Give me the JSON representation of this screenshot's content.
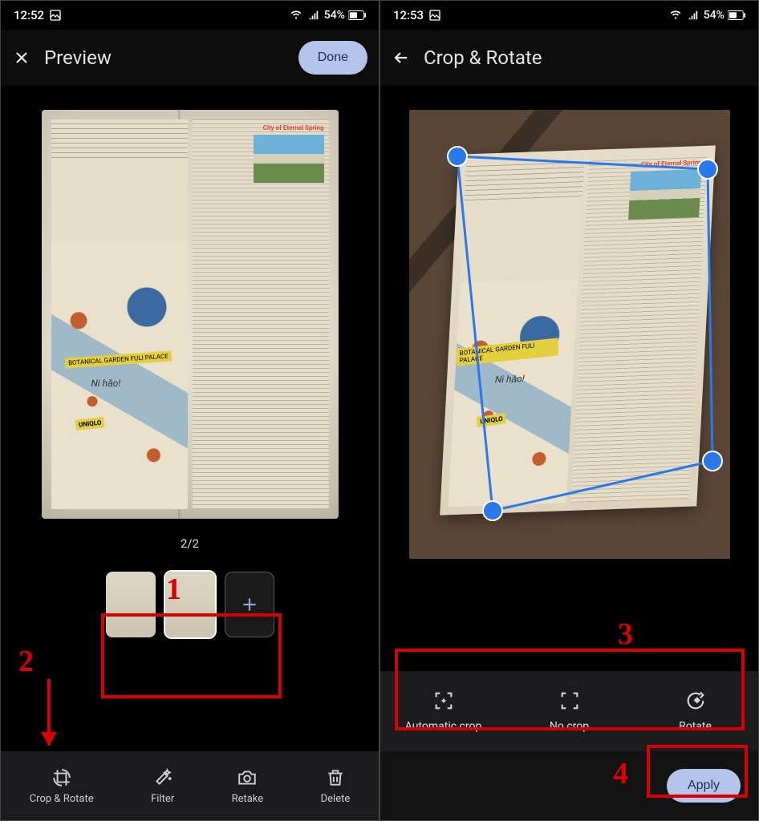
{
  "left": {
    "status_time": "12:52",
    "battery": "54%",
    "title": "Preview",
    "done": "Done",
    "page_counter": "2/2",
    "bottom": {
      "crop_rotate": "Crop & Rotate",
      "filter": "Filter",
      "retake": "Retake",
      "delete": "Delete"
    },
    "book": {
      "city_title": "City of Eternal Spring",
      "nihao": "Ni hǎo!",
      "garden": "BOTANICAL GARDEN FULI PALACE",
      "uniqlo": "UNIQLO"
    },
    "annotations": {
      "n1": "1",
      "n2": "2"
    }
  },
  "right": {
    "status_time": "12:53",
    "battery": "54%",
    "title": "Crop & Rotate",
    "crop_options": {
      "auto": "Automatic crop",
      "none": "No crop",
      "rotate": "Rotate"
    },
    "apply": "Apply",
    "book": {
      "city_title": "City of Eternal Spring",
      "nihao": "Ni hǎo!",
      "garden": "BOTANICAL GARDEN FULI PALACE",
      "uniqlo": "UNIQLO"
    },
    "annotations": {
      "n3": "3",
      "n4": "4"
    }
  }
}
